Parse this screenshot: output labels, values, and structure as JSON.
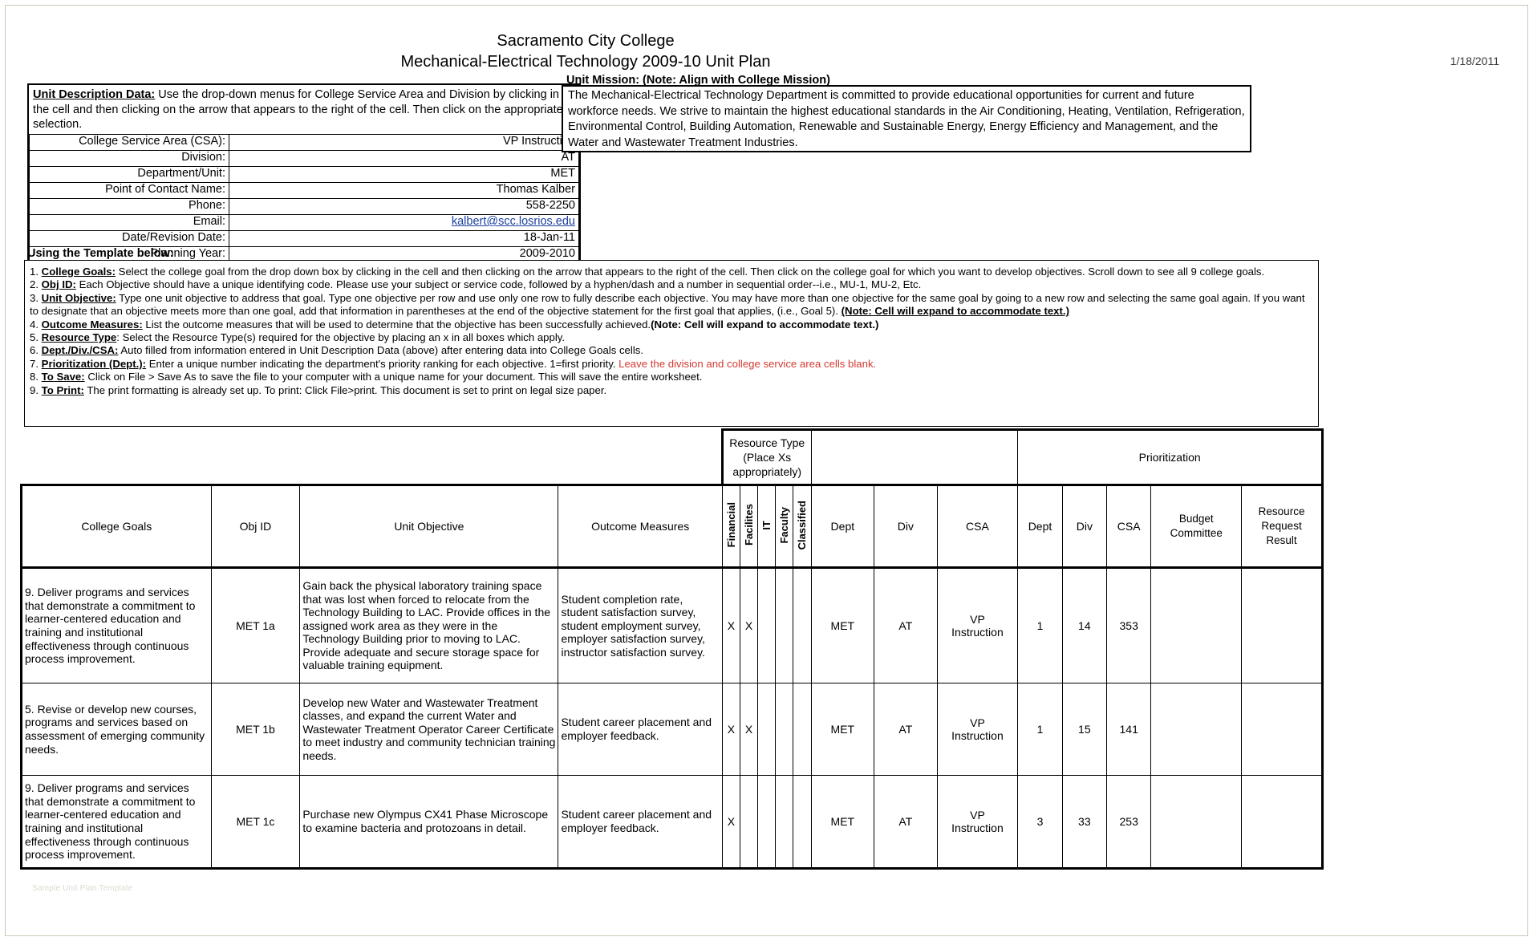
{
  "header": {
    "college": "Sacramento City College",
    "plan_title": "Mechanical-Electrical Technology 2009-10 Unit Plan",
    "date": "1/18/2011"
  },
  "unit_description": {
    "intro_bold": "Unit Description Data:",
    "intro_text": " Use the drop-down menus for College Service Area and Division by clicking in the cell and then clicking on the arrow that appears to the right of the cell. Then click on the appropriate selection.",
    "fields": [
      {
        "label": "College Service Area (CSA):",
        "value": "VP Instruction",
        "link": false
      },
      {
        "label": "Division:",
        "value": "AT",
        "link": false
      },
      {
        "label": "Department/Unit:",
        "value": "MET",
        "link": false
      },
      {
        "label": "Point of Contact Name:",
        "value": "Thomas Kalber",
        "link": false
      },
      {
        "label": "Phone:",
        "value": "558-2250",
        "link": false
      },
      {
        "label": "Email:",
        "value": "kalbert@scc.losrios.edu",
        "link": true
      },
      {
        "label": "Date/Revision Date:",
        "value": "18-Jan-11",
        "link": false
      },
      {
        "label": "Planning Year:",
        "value": "2009-2010",
        "link": false
      }
    ]
  },
  "mission": {
    "title": "Unit Mission:  (Note:  Align with College Mission)",
    "body": "The Mechanical-Electrical Technology Department is committed to provide educational opportunities for current and future workforce needs. We strive to maintain the highest educational standards in the Air Conditioning, Heating, Ventilation, Refrigeration, Environmental Control, Building Automation, Renewable and Sustainable Energy, Energy Efficiency and Management, and the Water and Wastewater Treatment Industries."
  },
  "using_template": {
    "heading": "Using the Template below:",
    "items": [
      {
        "num": "1.",
        "bold": "College Goals:",
        "text": " Select the college goal from the drop down box by clicking in the cell and then clicking on the arrow that appears to the right of the cell. Then click on the college goal for which you want to develop objectives. Scroll down to see all 9 college goals."
      },
      {
        "num": "2.",
        "bold": " Obj ID:",
        "text": "  Each Objective should have a unique identifying code.  Please use your subject or service code, followed by a hyphen/dash and a number in sequential order--i.e., MU-1, MU-2, Etc."
      },
      {
        "num": "3.",
        "bold": "Unit Objective:",
        "text": " Type one unit objective to address that goal. Type one objective per row and use only one row to fully describe each objective.  You may have more than one objective for the same goal by going to a new row and selecting the same goal again.  If you want to designate that an objective meets more than one goal, add that information in parentheses at the end of the objective statement for the first goal that applies, (i.e., Goal 5).  ",
        "note": "(Note: Cell will expand to accommodate text.)"
      },
      {
        "num": "4.",
        "bold": "Outcome Measures:",
        "text": " List the outcome measures that will be used to determine that the objective has been successfully achieved.",
        "note2": "(Note: Cell will expand to accommodate text.)"
      },
      {
        "num": "5.",
        "bold": "Resource Type",
        "text": ": Select the Resource Type(s) required for the objective by placing an x in all boxes which apply."
      },
      {
        "num": "6.",
        "bold": "Dept./Div./CSA:",
        "text": "  Auto filled from information entered in Unit Description Data (above) after entering data into College Goals cells."
      },
      {
        "num": "7.",
        "bold": "Prioritization (Dept.):",
        "text": " Enter a unique number indicating the department's priority ranking for each objective. 1=first priority. ",
        "red": "Leave the division and college service area cells blank."
      },
      {
        "num": "8.",
        "bold": "To Save:",
        "text": "  Click on File > Save As to save the file to your computer with a unique name for your document.  This will save the entire worksheet."
      },
      {
        "num": "9.",
        "bold": "To Print:",
        "text": "  The print formatting is already set up. To print:  Click File>print. This document is set to print on legal size paper."
      }
    ]
  },
  "grid": {
    "bands": {
      "resource_type": "Resource Type\n(Place Xs\nappropriately)",
      "resource_type_line1": "Resource Type",
      "resource_type_line2": "(Place Xs",
      "resource_type_line3": "appropriately)",
      "prioritization": "Prioritization"
    },
    "headers": {
      "college_goals": "College Goals",
      "obj_id": "Obj ID",
      "unit_objective": "Unit Objective",
      "outcome_measures": "Outcome Measures",
      "financial": "Financial",
      "facilities": "Facilites",
      "it": "IT",
      "faculty": "Faculty",
      "classified": "Classified",
      "dept1": "Dept",
      "div1": "Div",
      "csa1": "CSA",
      "dept2": "Dept",
      "div2": "Div",
      "csa2": "CSA",
      "budget_committee_l1": "Budget",
      "budget_committee_l2": "Committee",
      "resource_request_l1": "Resource",
      "resource_request_l2": "Request",
      "resource_request_l3": "Result"
    },
    "rows": [
      {
        "college_goal": "9. Deliver programs and services that demonstrate a commitment to learner-centered education and training and institutional effectiveness through continuous process improvement.",
        "obj_id": "MET 1a",
        "unit_objective": "Gain back the physical laboratory training space that was lost when forced to relocate from the Technology Building to LAC. Provide offices in the assigned work area as they were in the Technology Building prior to moving to LAC. Provide adequate and secure storage space for valuable training equipment.",
        "outcome_measures": "Student completion rate, student satisfaction survey, student employment survey, employer satisfaction survey, instructor satisfaction survey.",
        "financial": "X",
        "facilities": "X",
        "it": "",
        "faculty": "",
        "classified": "",
        "dept": "MET",
        "div": "AT",
        "csa_l1": "VP",
        "csa_l2": "Instruction",
        "p_dept": "1",
        "p_div": "14",
        "p_csa": "353",
        "budget_committee": "",
        "resource_request_result": ""
      },
      {
        "college_goal": "5. Revise or develop new courses, programs and services based on assessment of emerging community needs.",
        "obj_id": "MET 1b",
        "unit_objective": "Develop new Water and Wastewater Treatment classes, and expand the current Water and Wastewater Treatment Operator Career Certificate to meet industry and community technician training needs.",
        "outcome_measures": "Student career placement and employer feedback.",
        "financial": "X",
        "facilities": "X",
        "it": "",
        "faculty": "",
        "classified": "",
        "dept": "MET",
        "div": "AT",
        "csa_l1": "VP",
        "csa_l2": "Instruction",
        "p_dept": "1",
        "p_div": "15",
        "p_csa": "141",
        "budget_committee": "",
        "resource_request_result": ""
      },
      {
        "college_goal": "9. Deliver programs and services that demonstrate a commitment to learner-centered education and training and institutional effectiveness through continuous process improvement.",
        "obj_id": "MET 1c",
        "unit_objective": "Purchase new Olympus CX41 Phase Microscope to examine bacteria and protozoans in detail.",
        "outcome_measures": "Student career placement and employer feedback.",
        "financial": "X",
        "facilities": "",
        "it": "",
        "faculty": "",
        "classified": "",
        "dept": "MET",
        "div": "AT",
        "csa_l1": "VP",
        "csa_l2": "Instruction",
        "p_dept": "3",
        "p_div": "33",
        "p_csa": "253",
        "budget_committee": "",
        "resource_request_result": ""
      }
    ]
  },
  "watermark": "Sample Unit Plan Template"
}
